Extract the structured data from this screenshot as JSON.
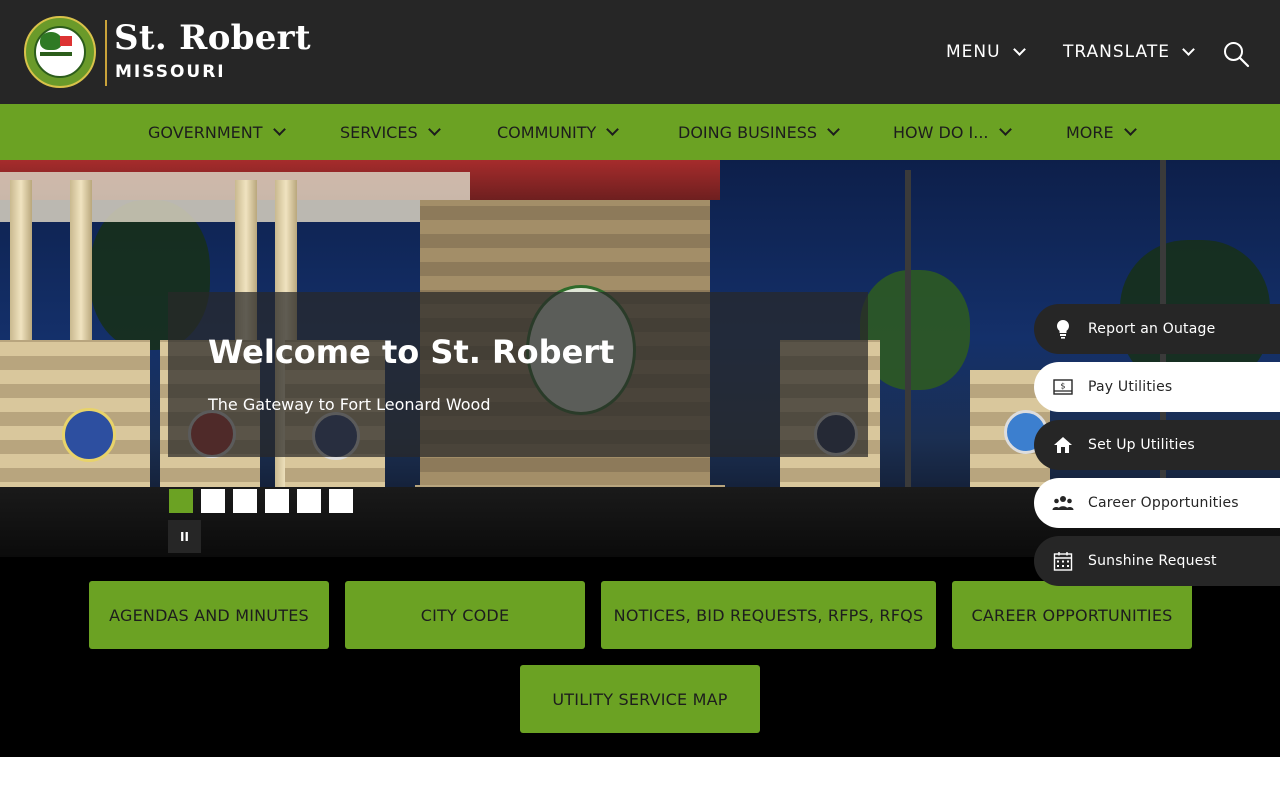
{
  "header": {
    "brand_title": "St. Robert",
    "brand_subtitle": "MISSOURI",
    "menu_label": "MENU",
    "translate_label": "TRANSLATE",
    "search_icon": "search-icon"
  },
  "nav": {
    "items": [
      {
        "label": "GOVERNMENT"
      },
      {
        "label": "SERVICES"
      },
      {
        "label": "COMMUNITY"
      },
      {
        "label": "DOING BUSINESS"
      },
      {
        "label": "HOW DO I..."
      },
      {
        "label": "MORE"
      }
    ]
  },
  "hero": {
    "title": "Welcome to St. Robert",
    "subtitle": "The Gateway to Fort Leonard Wood",
    "slide_count": 6,
    "active_slide": 1,
    "pause_label": "II"
  },
  "quick_links": [
    {
      "label": "AGENDAS AND MINUTES"
    },
    {
      "label": "CITY CODE"
    },
    {
      "label": "NOTICES, BID REQUESTS, RFPS, RFQS"
    },
    {
      "label": "CAREER OPPORTUNITIES"
    },
    {
      "label": "UTILITY SERVICE MAP"
    }
  ],
  "side_links": [
    {
      "label": "Report an Outage",
      "icon": "lightbulb-icon"
    },
    {
      "label": "Pay Utilities",
      "icon": "bill-icon"
    },
    {
      "label": "Set Up Utilities",
      "icon": "house-icon"
    },
    {
      "label": "Career Opportunities",
      "icon": "people-icon"
    },
    {
      "label": "Sunshine Request",
      "icon": "calendar-icon"
    }
  ],
  "colors": {
    "accent_green": "#6ba223",
    "header_dark": "#262626",
    "quick_area_bg": "#000000",
    "divider_gold": "#c9a23a"
  }
}
